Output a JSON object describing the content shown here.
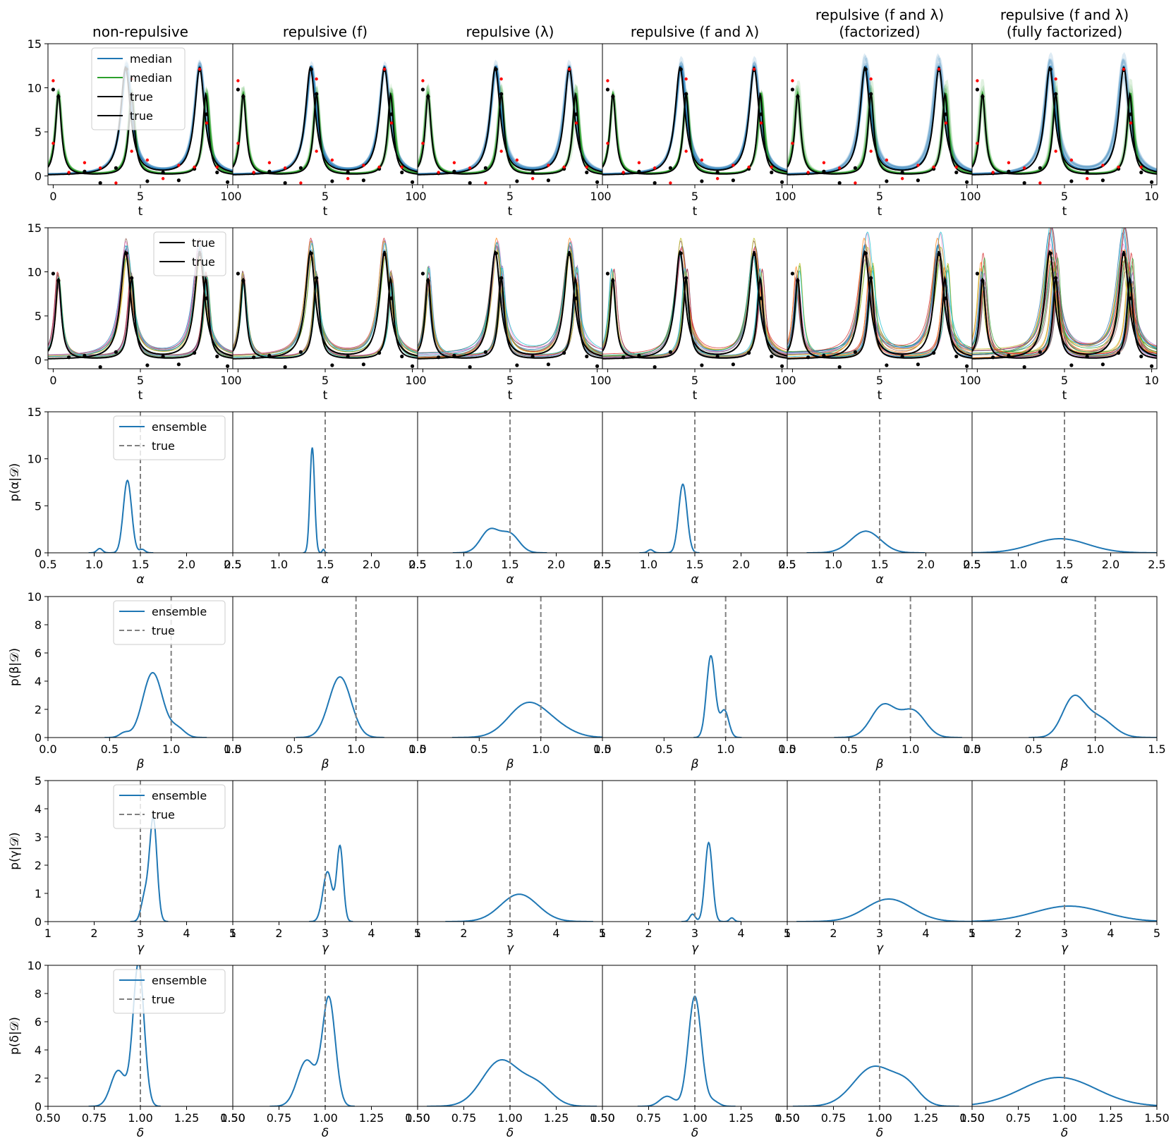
{
  "figure": {
    "column_titles": [
      [
        "non-repulsive"
      ],
      [
        "repulsive (f)"
      ],
      [
        "repulsive (λ)"
      ],
      [
        "repulsive (f and λ)"
      ],
      [
        "repulsive (f and λ)",
        "(factorized)"
      ],
      [
        "repulsive (f and λ)",
        "(fully factorized)"
      ]
    ],
    "colors": {
      "blue": "#1f77b4",
      "green": "#2ca02c",
      "black": "#000000",
      "red": "#ff0000",
      "grey_dashed": "#808080",
      "member_palette": [
        "#1f77b4",
        "#ff7f0e",
        "#2ca02c",
        "#d62728",
        "#9467bd",
        "#8c564b",
        "#e377c2",
        "#7f7f7f",
        "#bcbd22",
        "#17becf"
      ]
    }
  },
  "chart_data": [
    {
      "row": 1,
      "type": "line",
      "description_of_series": "posterior median trajectories with shaded uncertainty, true trajectories and observations",
      "xlabel": "t",
      "ylabel": "",
      "xlim": [
        -0.3,
        10.3
      ],
      "ylim": [
        -1,
        15
      ],
      "x_ticks": [
        0,
        5,
        10
      ],
      "y_ticks": [
        0,
        5,
        10,
        15
      ],
      "legend": {
        "location": "upper-center",
        "entries": [
          {
            "label": "median",
            "color": "#1f77b4",
            "style": "solid"
          },
          {
            "label": "median",
            "color": "#2ca02c",
            "style": "solid"
          },
          {
            "label": "true",
            "color": "#000000",
            "style": "solid"
          },
          {
            "label": "true",
            "color": "#000000",
            "style": "solid"
          }
        ]
      },
      "series": [
        {
          "name": "median",
          "color": "#1f77b4",
          "peaks_t": [
            4.2,
            8.4
          ],
          "peak_height": 12.3,
          "base": 0.1
        },
        {
          "name": "median",
          "color": "#2ca02c",
          "peaks_t": [
            0.3,
            4.5,
            8.8
          ],
          "peak_height": 9.3,
          "base": 0.1
        },
        {
          "name": "true",
          "color": "#000000",
          "peaks_t": [
            4.15,
            8.4
          ],
          "peak_height": 12.2
        },
        {
          "name": "true",
          "color": "#000000",
          "peaks_t": [
            0.3,
            4.5,
            8.75
          ],
          "peak_height": 9.2
        }
      ],
      "observations_black": [
        [
          0,
          9.8
        ],
        [
          0.3,
          9.0
        ],
        [
          0.9,
          0.3
        ],
        [
          1.8,
          0.5
        ],
        [
          2.7,
          -0.8
        ],
        [
          3.6,
          0.9
        ],
        [
          4.2,
          12.1
        ],
        [
          4.5,
          9.3
        ],
        [
          5.4,
          -0.6
        ],
        [
          6.3,
          0.4
        ],
        [
          7.2,
          -0.5
        ],
        [
          8.1,
          0.8
        ],
        [
          8.4,
          12.0
        ],
        [
          8.8,
          7.0
        ],
        [
          9.4,
          0.4
        ],
        [
          10,
          -0.7
        ]
      ],
      "observations_red": [
        [
          0,
          10.8
        ],
        [
          0,
          3.7
        ],
        [
          0.9,
          0.4
        ],
        [
          1.8,
          1.5
        ],
        [
          2.7,
          0.9
        ],
        [
          3.6,
          -0.8
        ],
        [
          4.5,
          11.0
        ],
        [
          4.5,
          2.8
        ],
        [
          5.4,
          1.8
        ],
        [
          6.3,
          -0.3
        ],
        [
          7.2,
          1.2
        ],
        [
          8.1,
          1.0
        ],
        [
          8.4,
          12.1
        ],
        [
          8.8,
          6.0
        ],
        [
          9.4,
          1.0
        ]
      ],
      "panel_spread": [
        0.4,
        0.5,
        0.8,
        0.6,
        0.9,
        1.2
      ]
    },
    {
      "row": 2,
      "type": "line",
      "description_of_series": "individual ensemble member trajectories with true trajectories and observations",
      "xlabel": "t",
      "ylabel": "",
      "xlim": [
        -0.3,
        10.3
      ],
      "ylim": [
        -1,
        15
      ],
      "x_ticks": [
        0,
        5,
        10
      ],
      "y_ticks": [
        0,
        5,
        10,
        15
      ],
      "legend": {
        "location": "upper-right",
        "entries": [
          {
            "label": "true",
            "color": "#000000",
            "style": "solid"
          },
          {
            "label": "true",
            "color": "#000000",
            "style": "solid"
          }
        ]
      },
      "members_per_panel": [
        10,
        10,
        10,
        10,
        12,
        14
      ],
      "panel_spread": [
        0.6,
        0.5,
        0.8,
        0.6,
        1.0,
        1.3
      ]
    },
    {
      "row": 3,
      "type": "line",
      "xlabel": "α",
      "ylabel": "p(α|𝒟)",
      "xlim": [
        0.5,
        2.5
      ],
      "ylim": [
        0,
        15
      ],
      "x_ticks": [
        0.5,
        1.0,
        1.5,
        2.0,
        2.5
      ],
      "x_tick_labels": [
        "0.5",
        "1.0",
        "1.5",
        "2.0",
        "2.5"
      ],
      "y_ticks": [
        0,
        5,
        10,
        15
      ],
      "true_value": 1.5,
      "legend": {
        "location": "upper-center",
        "entries": [
          {
            "label": "ensemble",
            "color": "#1f77b4",
            "style": "solid"
          },
          {
            "label": "true",
            "color": "#808080",
            "style": "dashed"
          }
        ]
      },
      "panels": [
        {
          "components": [
            [
              1.36,
              0.045,
              0.85
            ],
            [
              1.06,
              0.03,
              0.05
            ],
            [
              1.52,
              0.03,
              0.04
            ]
          ],
          "peak": 7.7
        },
        {
          "components": [
            [
              1.36,
              0.025,
              0.92
            ],
            [
              1.48,
              0.012,
              0.03
            ]
          ],
          "peak": 11.2
        },
        {
          "components": [
            [
              1.28,
              0.1,
              0.55
            ],
            [
              1.5,
              0.1,
              0.45
            ]
          ],
          "peak": 2.6
        },
        {
          "components": [
            [
              1.37,
              0.045,
              0.88
            ],
            [
              1.02,
              0.03,
              0.04
            ]
          ],
          "peak": 7.3
        },
        {
          "components": [
            [
              1.35,
              0.16,
              1.0
            ]
          ],
          "peak": 2.3
        },
        {
          "components": [
            [
              1.45,
              0.3,
              1.0
            ]
          ],
          "peak": 1.5
        }
      ]
    },
    {
      "row": 4,
      "type": "line",
      "xlabel": "β",
      "ylabel": "p(β|𝒟)",
      "xlim": [
        0.0,
        1.5
      ],
      "ylim": [
        0,
        10
      ],
      "x_ticks": [
        0.0,
        0.5,
        1.0,
        1.5
      ],
      "x_tick_labels": [
        "0.0",
        "0.5",
        "1.0",
        "1.5"
      ],
      "y_ticks": [
        0,
        2,
        4,
        6,
        8,
        10
      ],
      "true_value": 1.0,
      "legend": {
        "location": "upper-center",
        "entries": [
          {
            "label": "ensemble",
            "color": "#1f77b4",
            "style": "solid"
          },
          {
            "label": "true",
            "color": "#808080",
            "style": "dashed"
          }
        ]
      },
      "panels": [
        {
          "components": [
            [
              0.85,
              0.08,
              0.85
            ],
            [
              0.62,
              0.04,
              0.06
            ],
            [
              1.05,
              0.06,
              0.12
            ]
          ],
          "peak": 4.6
        },
        {
          "components": [
            [
              0.87,
              0.09,
              1.0
            ]
          ],
          "peak": 4.3
        },
        {
          "components": [
            [
              0.88,
              0.15,
              0.75
            ],
            [
              1.1,
              0.15,
              0.25
            ]
          ],
          "peak": 2.5
        },
        {
          "components": [
            [
              0.88,
              0.035,
              0.75
            ],
            [
              0.99,
              0.035,
              0.25
            ]
          ],
          "peak": 5.8
        },
        {
          "components": [
            [
              0.78,
              0.1,
              0.55
            ],
            [
              1.02,
              0.1,
              0.45
            ]
          ],
          "peak": 2.4
        },
        {
          "components": [
            [
              0.82,
              0.09,
              0.65
            ],
            [
              1.02,
              0.12,
              0.35
            ]
          ],
          "peak": 3.0
        }
      ]
    },
    {
      "row": 5,
      "type": "line",
      "xlabel": "γ",
      "ylabel": "p(γ|𝒟)",
      "xlim": [
        1,
        5
      ],
      "ylim": [
        0,
        5
      ],
      "x_ticks": [
        1,
        2,
        3,
        4,
        5
      ],
      "x_tick_labels": [
        "1",
        "2",
        "3",
        "4",
        "5"
      ],
      "y_ticks": [
        0,
        1,
        2,
        3,
        4,
        5
      ],
      "true_value": 3.0,
      "legend": {
        "location": "upper-center",
        "entries": [
          {
            "label": "ensemble",
            "color": "#1f77b4",
            "style": "solid"
          },
          {
            "label": "true",
            "color": "#808080",
            "style": "dashed"
          }
        ]
      },
      "panels": [
        {
          "components": [
            [
              3.28,
              0.08,
              0.8
            ],
            [
              3.1,
              0.08,
              0.2
            ]
          ],
          "peak": 3.7
        },
        {
          "components": [
            [
              3.32,
              0.07,
              0.6
            ],
            [
              3.05,
              0.1,
              0.4
            ]
          ],
          "peak": 2.7
        },
        {
          "components": [
            [
              3.2,
              0.4,
              1.0
            ]
          ],
          "peak": 0.97
        },
        {
          "components": [
            [
              3.3,
              0.08,
              0.85
            ],
            [
              2.95,
              0.06,
              0.08
            ],
            [
              3.8,
              0.05,
              0.04
            ]
          ],
          "peak": 2.8
        },
        {
          "components": [
            [
              3.2,
              0.5,
              1.0
            ]
          ],
          "peak": 0.8
        },
        {
          "components": [
            [
              3.1,
              0.75,
              1.0
            ]
          ],
          "peak": 0.55
        }
      ]
    },
    {
      "row": 6,
      "type": "line",
      "xlabel": "δ",
      "ylabel": "p(δ|𝒟)",
      "xlim": [
        0.5,
        1.5
      ],
      "ylim": [
        0,
        10
      ],
      "x_ticks": [
        0.5,
        0.75,
        1.0,
        1.25,
        1.5
      ],
      "x_tick_labels": [
        "0.50",
        "0.75",
        "1.00",
        "1.25",
        "1.50"
      ],
      "y_ticks": [
        0,
        2,
        4,
        6,
        8,
        10
      ],
      "true_value": 1.0,
      "legend": {
        "location": "upper-center",
        "entries": [
          {
            "label": "ensemble",
            "color": "#1f77b4",
            "style": "solid"
          },
          {
            "label": "true",
            "color": "#808080",
            "style": "dashed"
          }
        ]
      },
      "panels": [
        {
          "components": [
            [
              0.99,
              0.03,
              0.8
            ],
            [
              0.88,
              0.04,
              0.2
            ]
          ],
          "peak": 10.2
        },
        {
          "components": [
            [
              1.02,
              0.035,
              0.7
            ],
            [
              0.9,
              0.05,
              0.3
            ]
          ],
          "peak": 7.8
        },
        {
          "components": [
            [
              0.95,
              0.1,
              0.7
            ],
            [
              1.15,
              0.08,
              0.3
            ]
          ],
          "peak": 3.3
        },
        {
          "components": [
            [
              1.0,
              0.035,
              0.88
            ],
            [
              0.85,
              0.04,
              0.08
            ],
            [
              1.1,
              0.03,
              0.04
            ]
          ],
          "peak": 7.8
        },
        {
          "components": [
            [
              0.97,
              0.11,
              0.7
            ],
            [
              1.15,
              0.07,
              0.3
            ]
          ],
          "peak": 2.85
        },
        {
          "components": [
            [
              0.97,
              0.2,
              1.0
            ]
          ],
          "peak": 2.05
        }
      ]
    }
  ]
}
